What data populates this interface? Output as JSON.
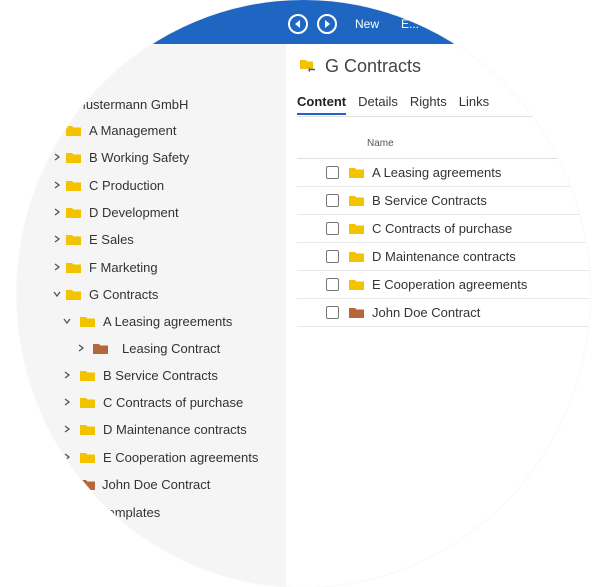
{
  "topbar": {
    "new_label": "New",
    "partial_label": "E..."
  },
  "tree": {
    "root": "Mustermann GmbH",
    "items": [
      {
        "label": "A Management"
      },
      {
        "label": "B Working Safety"
      },
      {
        "label": "C Production"
      },
      {
        "label": "D Development"
      },
      {
        "label": "E Sales"
      },
      {
        "label": "F Marketing"
      },
      {
        "label": "G Contracts"
      },
      {
        "label": "A Leasing agreements"
      },
      {
        "label": "Leasing Contract"
      },
      {
        "label": "B Service Contracts"
      },
      {
        "label": "C Contracts of purchase"
      },
      {
        "label": "D Maintenance contracts"
      },
      {
        "label": "E Cooperation agreements"
      },
      {
        "label": "John Doe Contract"
      },
      {
        "label": "Templates"
      }
    ]
  },
  "main": {
    "title": "G Contracts",
    "tabs": [
      "Content",
      "Details",
      "Rights",
      "Links"
    ],
    "column_name": "Name",
    "rows": [
      {
        "label": "A Leasing agreements"
      },
      {
        "label": "B Service Contracts"
      },
      {
        "label": "C Contracts of purchase"
      },
      {
        "label": "D Maintenance contracts"
      },
      {
        "label": "E Cooperation agreements"
      },
      {
        "label": "John Doe Contract"
      }
    ]
  },
  "colors": {
    "accent": "#1f66c2",
    "folder": "#f3c300",
    "folder_brown": "#b5663a"
  }
}
